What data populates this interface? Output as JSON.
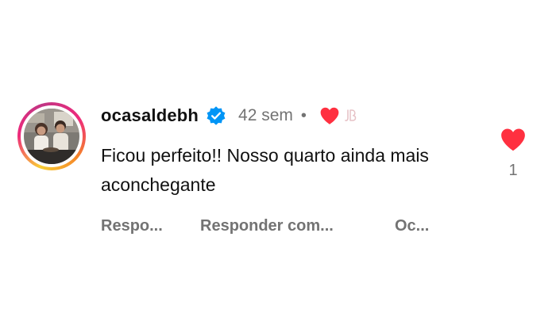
{
  "comment": {
    "username": "ocasaldebh",
    "time_ago": "42 sem",
    "separator": "•",
    "text": "Ficou perfeito!! Nosso quarto ainda mais aconchegante",
    "verified_icon": "verified-badge-icon",
    "creator_liked_icon": "heart-icon",
    "creator_badge_icon": "jb-logo-icon"
  },
  "actions": {
    "reply": "Respo...",
    "reply_with": "Responder com...",
    "hide": "Oc..."
  },
  "like": {
    "count": "1",
    "icon": "heart-icon"
  },
  "colors": {
    "like_red": "#ff3040",
    "verified_blue": "#0095f6",
    "muted_text": "#737373"
  }
}
